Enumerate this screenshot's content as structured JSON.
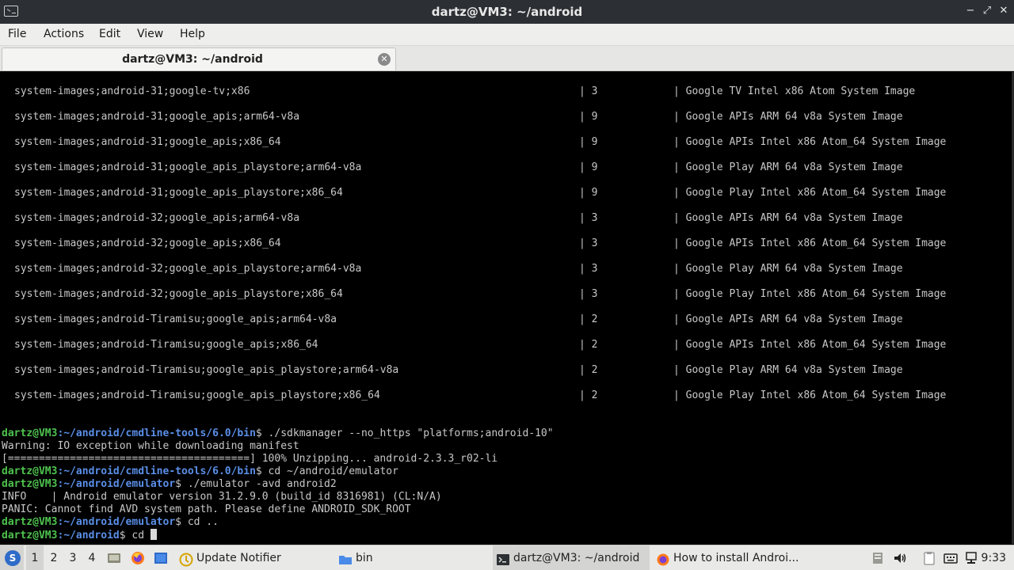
{
  "window": {
    "title": "dartz@VM3: ~/android",
    "minimize": "−",
    "maximize": "⤢",
    "close": "✕"
  },
  "menu": [
    "File",
    "Actions",
    "Edit",
    "View",
    "Help"
  ],
  "tab": {
    "label": "dartz@VM3: ~/android",
    "close": "✕"
  },
  "packages": [
    {
      "path": "system-images;android-31;google-tv;x86",
      "version": "| 3",
      "desc": "| Google TV Intel x86 Atom System Image"
    },
    {
      "path": "system-images;android-31;google_apis;arm64-v8a",
      "version": "| 9",
      "desc": "| Google APIs ARM 64 v8a System Image"
    },
    {
      "path": "system-images;android-31;google_apis;x86_64",
      "version": "| 9",
      "desc": "| Google APIs Intel x86 Atom_64 System Image"
    },
    {
      "path": "system-images;android-31;google_apis_playstore;arm64-v8a",
      "version": "| 9",
      "desc": "| Google Play ARM 64 v8a System Image"
    },
    {
      "path": "system-images;android-31;google_apis_playstore;x86_64",
      "version": "| 9",
      "desc": "| Google Play Intel x86 Atom_64 System Image"
    },
    {
      "path": "system-images;android-32;google_apis;arm64-v8a",
      "version": "| 3",
      "desc": "| Google APIs ARM 64 v8a System Image"
    },
    {
      "path": "system-images;android-32;google_apis;x86_64",
      "version": "| 3",
      "desc": "| Google APIs Intel x86 Atom_64 System Image"
    },
    {
      "path": "system-images;android-32;google_apis_playstore;arm64-v8a",
      "version": "| 3",
      "desc": "| Google Play ARM 64 v8a System Image"
    },
    {
      "path": "system-images;android-32;google_apis_playstore;x86_64",
      "version": "| 3",
      "desc": "| Google Play Intel x86 Atom_64 System Image"
    },
    {
      "path": "system-images;android-Tiramisu;google_apis;arm64-v8a",
      "version": "| 2",
      "desc": "| Google APIs ARM 64 v8a System Image"
    },
    {
      "path": "system-images;android-Tiramisu;google_apis;x86_64",
      "version": "| 2",
      "desc": "| Google APIs Intel x86 Atom_64 System Image"
    },
    {
      "path": "system-images;android-Tiramisu;google_apis_playstore;arm64-v8a",
      "version": "| 2",
      "desc": "| Google Play ARM 64 v8a System Image"
    },
    {
      "path": "system-images;android-Tiramisu;google_apis_playstore;x86_64",
      "version": "| 2",
      "desc": "| Google Play Intel x86 Atom_64 System Image"
    }
  ],
  "session": [
    {
      "type": "prompt",
      "user": "dartz@VM3",
      "path": ":~/android/cmdline-tools/6.0/bin",
      "cmd": "$ ./sdkmanager --no_https \"platforms;android-10\""
    },
    {
      "type": "output",
      "text": "Warning: IO exception while downloading manifest"
    },
    {
      "type": "output",
      "text": "[=======================================] 100% Unzipping... android-2.3.3_r02-li"
    },
    {
      "type": "prompt",
      "user": "dartz@VM3",
      "path": ":~/android/cmdline-tools/6.0/bin",
      "cmd": "$ cd ~/android/emulator"
    },
    {
      "type": "prompt",
      "user": "dartz@VM3",
      "path": ":~/android/emulator",
      "cmd": "$ ./emulator -avd android2"
    },
    {
      "type": "output",
      "text": "INFO    | Android emulator version 31.2.9.0 (build_id 8316981) (CL:N/A)"
    },
    {
      "type": "output",
      "text": "PANIC: Cannot find AVD system path. Please define ANDROID_SDK_ROOT"
    },
    {
      "type": "prompt",
      "user": "dartz@VM3",
      "path": ":~/android/emulator",
      "cmd": "$ cd .."
    },
    {
      "type": "prompt",
      "user": "dartz@VM3",
      "path": ":~/android",
      "cmd": "$ cd "
    }
  ],
  "taskbar": {
    "start_glyph": "S",
    "workspaces": [
      "1",
      "2",
      "3",
      "4"
    ],
    "tasks": [
      {
        "label": "Update Notifier",
        "icon": "update-notifier-icon"
      },
      {
        "label": "bin",
        "icon": "folder-icon"
      },
      {
        "label": "dartz@VM3: ~/android",
        "icon": "terminal-icon"
      },
      {
        "label": "How to install Androi...",
        "icon": "firefox-icon"
      }
    ],
    "clock": "9:33"
  },
  "colors": {
    "prompt_user": "#4ec24e",
    "prompt_path": "#5a8fe8",
    "terminal_bg": "#000000",
    "terminal_fg": "#c8c8c8"
  }
}
